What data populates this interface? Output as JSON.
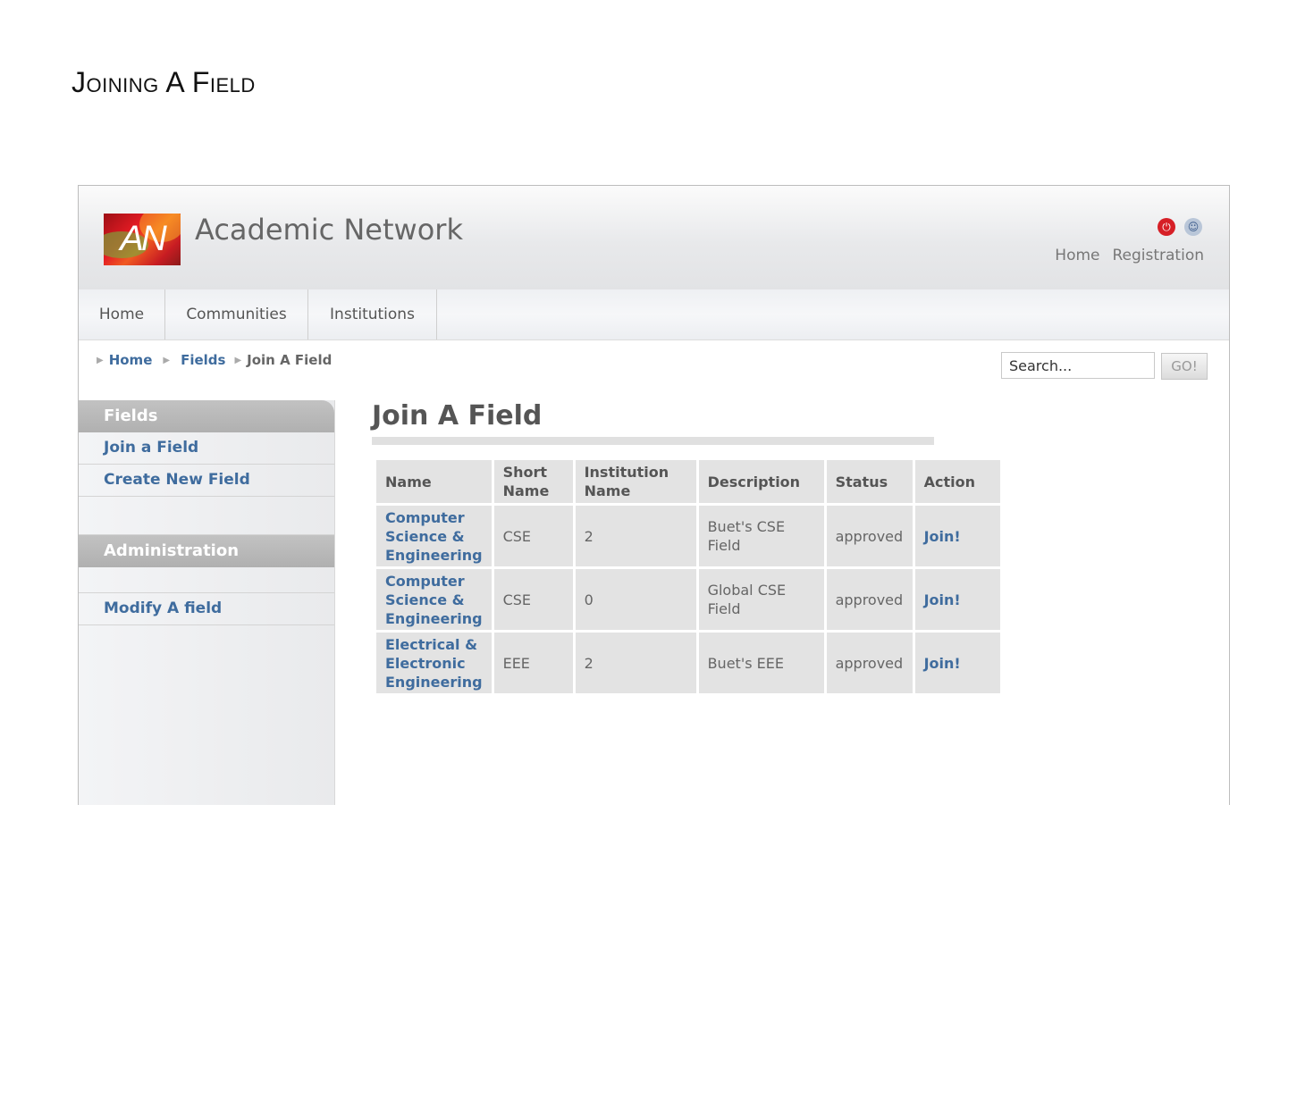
{
  "document": {
    "title": "Joining A Field"
  },
  "header": {
    "logo_text": "AN",
    "site_title": "Academic Network",
    "top_links": [
      "Home",
      "Registration"
    ]
  },
  "nav": {
    "items": [
      "Home",
      "Communities",
      "Institutions"
    ]
  },
  "breadcrumb": {
    "home": "Home",
    "fields": "Fields",
    "current": "Join A Field"
  },
  "search": {
    "placeholder": "Search...",
    "go_label": "GO!"
  },
  "sidebar": {
    "fields_header": "Fields",
    "fields_items": [
      "Join a Field",
      "Create New Field"
    ],
    "admin_header": "Administration",
    "admin_items": [
      "Modify A field"
    ]
  },
  "main": {
    "heading": "Join A Field",
    "table": {
      "headers": [
        "Name",
        "Short Name",
        "Institution Name",
        "Description",
        "Status",
        "Action"
      ],
      "rows": [
        {
          "name": "Computer Science & Engineering",
          "short": "CSE",
          "institution": "2",
          "description": "Buet's CSE Field",
          "status": "approved",
          "action": "Join!"
        },
        {
          "name": "Computer Science & Engineering",
          "short": "CSE",
          "institution": "0",
          "description": "Global CSE Field",
          "status": "approved",
          "action": "Join!"
        },
        {
          "name": "Electrical & Electronic Engineering",
          "short": "EEE",
          "institution": "2",
          "description": "Buet's EEE",
          "status": "approved",
          "action": "Join!"
        }
      ]
    }
  },
  "colors": {
    "link": "#3f6c9e",
    "sidebar_header": "#b8b8b8",
    "table_cell": "#e3e3e3",
    "logo_red": "#e31b23"
  }
}
